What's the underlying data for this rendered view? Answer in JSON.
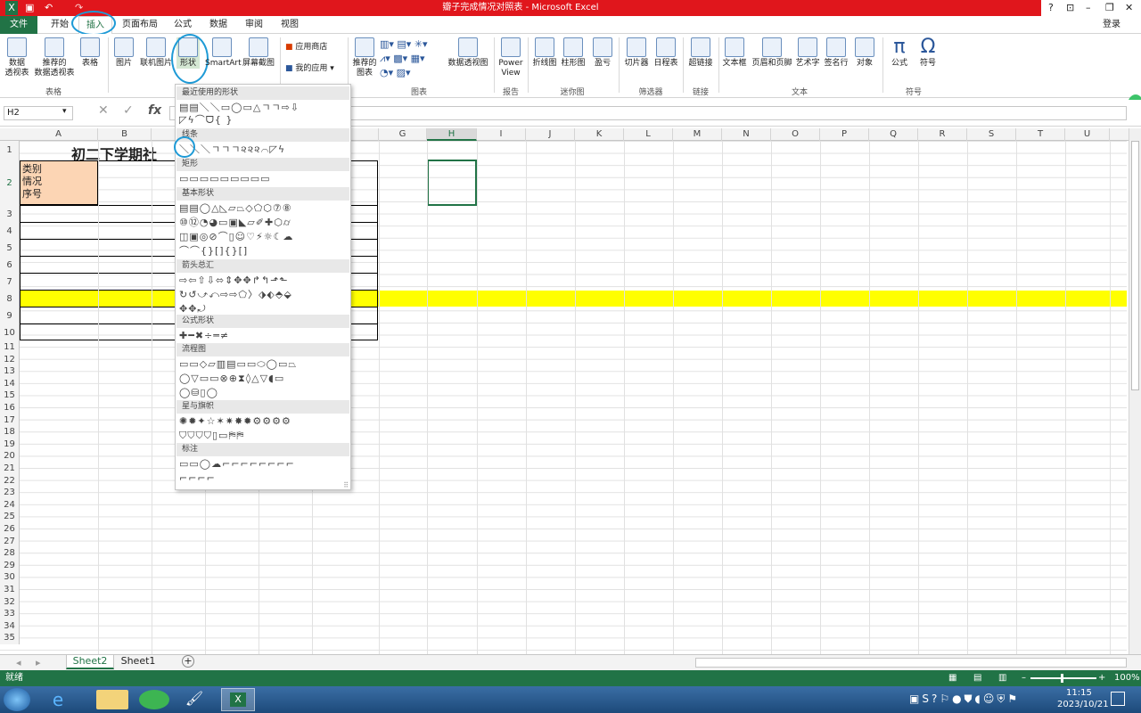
{
  "window": {
    "title": "瓣子完成情况对照表 - Microsoft Excel",
    "help": "?",
    "signin": "登录"
  },
  "tabs": [
    "文件",
    "开始",
    "插入",
    "页面布局",
    "公式",
    "数据",
    "审阅",
    "视图"
  ],
  "ribbon": {
    "buttons": [
      "数据\n透视表",
      "推荐的\n数据透视表",
      "表格",
      "图片",
      "联机图片",
      "形状",
      "SmartArt",
      "屏幕截图",
      "应用商店",
      "我的应用",
      "推荐的\n图表",
      "数据透视图",
      "Power\nView",
      "折线图",
      "柱形图",
      "盈亏",
      "切片器",
      "日程表",
      "超链接",
      "文本框",
      "页眉和页脚",
      "艺术字",
      "签名行",
      "对象",
      "公式",
      "符号"
    ],
    "groups": [
      "表格",
      "图表",
      "报告",
      "迷你图",
      "筛选器",
      "链接",
      "文本",
      "符号"
    ]
  },
  "formula_bar": {
    "name_box": "H2",
    "fx": "fx"
  },
  "columns": [
    "A",
    "B",
    "C",
    "D",
    "E",
    "F",
    "G",
    "H",
    "I",
    "J",
    "K",
    "L",
    "M",
    "N",
    "O",
    "P",
    "Q",
    "R",
    "S",
    "T",
    "U"
  ],
  "rows": [
    "1",
    "2",
    "3",
    "4",
    "5",
    "6",
    "7",
    "8",
    "9",
    "10",
    "11",
    "12",
    "13",
    "14",
    "15",
    "16",
    "17",
    "18",
    "19",
    "20",
    "21",
    "22",
    "23",
    "24",
    "25",
    "26",
    "27",
    "28",
    "29",
    "30",
    "31",
    "32",
    "33",
    "34",
    "35"
  ],
  "cells": {
    "title": "初二下学期社",
    "header_cell": "类别\n情况\n序号"
  },
  "shapes_menu": {
    "sections": [
      "最近使用的形状",
      "线条",
      "矩形",
      "基本形状",
      "箭头总汇",
      "公式形状",
      "流程图",
      "星与旗帜",
      "标注"
    ]
  },
  "sheets": [
    "Sheet2",
    "Sheet1"
  ],
  "status": {
    "ready": "就绪",
    "zoom": "100%"
  },
  "taskbar": {
    "time": "11:15",
    "date": "2023/10/21"
  },
  "colors": {
    "accent": "#217346",
    "title_red": "#e0161c",
    "highlight": "#ffff00",
    "header_fill": "#fcd5b4"
  }
}
